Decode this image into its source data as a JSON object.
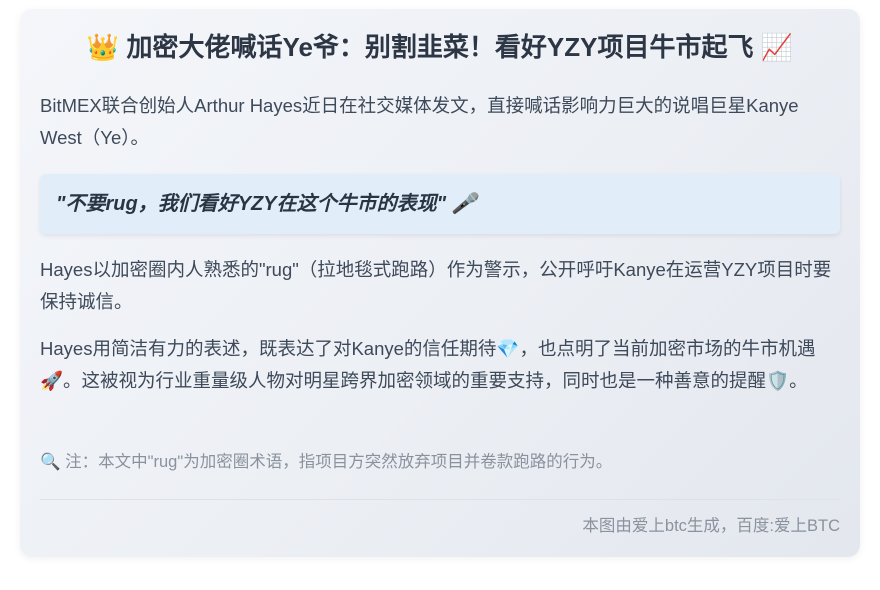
{
  "article": {
    "title_emoji_left": "👑",
    "title": "加密大佬喊话Ye爷：别割韭菜！看好YZY项目牛市起飞",
    "title_emoji_right": "📈",
    "intro": "BitMEX联合创始人Arthur Hayes近日在社交媒体发文，直接喊话影响力巨大的说唱巨星Kanye West（Ye）。",
    "quote": "\"不要rug，我们看好YZY在这个牛市的表现\"",
    "quote_emoji": "🎤",
    "paragraph2": "Hayes以加密圈内人熟悉的\"rug\"（拉地毯式跑路）作为警示，公开呼吁Kanye在运营YZY项目时要保持诚信。",
    "paragraph3_a": "Hayes用简洁有力的表述，既表达了对Kanye的信任期待",
    "paragraph3_emoji1": "💎",
    "paragraph3_b": "，也点明了当前加密市场的牛市机遇",
    "paragraph3_emoji2": "🚀",
    "paragraph3_c": "。这被视为行业重量级人物对明星跨界加密领域的重要支持，同时也是一种善意的提醒",
    "paragraph3_emoji3": "🛡️",
    "paragraph3_d": "。",
    "note_emoji": "🔍",
    "note": "注：本文中\"rug\"为加密圈术语，指项目方突然放弃项目并卷款跑路的行为。",
    "footer": "本图由爱上btc生成，百度:爱上BTC"
  }
}
